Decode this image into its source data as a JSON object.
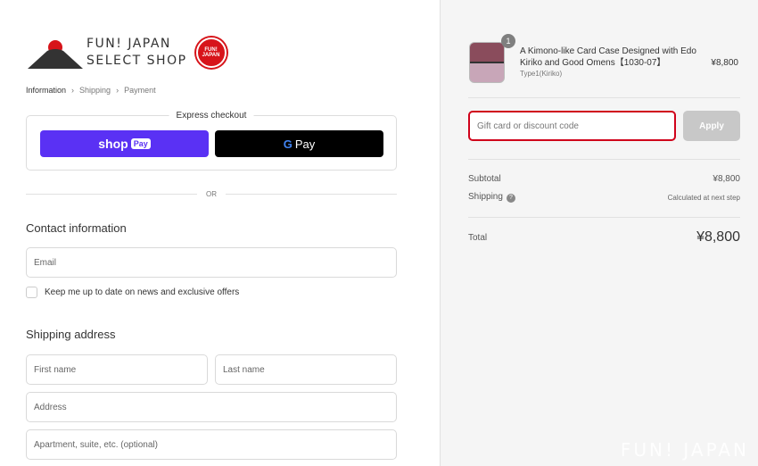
{
  "logo": {
    "line1": "FUN! JAPAN",
    "line2": "SELECT SHOP",
    "seal": "FUN! JAPAN"
  },
  "breadcrumb": [
    "Information",
    "Shipping",
    "Payment"
  ],
  "express": {
    "title": "Express checkout",
    "shop": "shop",
    "shop_pay": "Pay",
    "gpay_g": "G",
    "gpay": "Pay"
  },
  "or": "OR",
  "contact": {
    "title": "Contact information",
    "email_placeholder": "Email",
    "newsletter": "Keep me up to date on news and exclusive offers"
  },
  "shipping": {
    "title": "Shipping address",
    "first": "First name",
    "last": "Last name",
    "address": "Address",
    "apartment": "Apartment, suite, etc. (optional)"
  },
  "cart": {
    "qty": "1",
    "name": "A Kimono-like Card Case Designed with Edo Kiriko and Good Omens【1030-07】",
    "variant": "Type1(Kiriko)",
    "price": "¥8,800"
  },
  "discount": {
    "placeholder": "Gift card or discount code",
    "apply": "Apply"
  },
  "summary": {
    "subtotal_label": "Subtotal",
    "subtotal": "¥8,800",
    "shipping_label": "Shipping",
    "shipping": "Calculated at next step",
    "total_label": "Total",
    "total": "¥8,800"
  },
  "watermark": "FUN! JAPAN",
  "colors": {
    "shop_pay": "#5a31f4",
    "discount_border": "#d0021b"
  }
}
